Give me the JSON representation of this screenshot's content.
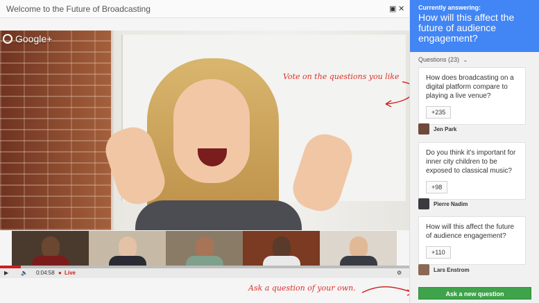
{
  "window": {
    "title": "Welcome to the Future of Broadcasting"
  },
  "video": {
    "brand": "Google+",
    "annotations": {
      "vote": "Vote on the questions you like",
      "ask": "Ask a question of your own."
    },
    "controls": {
      "time": "0:04:58",
      "live": "Live",
      "progress_fraction": 0.05
    }
  },
  "panel": {
    "currently_label": "Currently answering:",
    "current_question": "How will this affect the future of audience engagement?",
    "questions_count_label": "Questions (23)",
    "questions": [
      {
        "text": "How does broadcasting on a digital platform compare to playing a live venue?",
        "votes": "+235",
        "author": "Jen Park"
      },
      {
        "text": "Do you think it’s important for inner city children to be exposed to classical music?",
        "votes": "+98",
        "author": "Pierre Nadim"
      },
      {
        "text": "How will this affect the future of audience engagement?",
        "votes": "+110",
        "author": "Lars Enstrom"
      }
    ],
    "ask_button": "Ask a new question"
  },
  "colors": {
    "accent": "#4285f4",
    "button": "#3ea34a",
    "annotation": "#e0302a",
    "live": "#cc1f1f"
  },
  "icons": [
    "gplus-logo-icon",
    "popout-icon",
    "close-icon",
    "play-icon",
    "volume-icon",
    "settings-gear-icon",
    "chevron-down-icon"
  ]
}
